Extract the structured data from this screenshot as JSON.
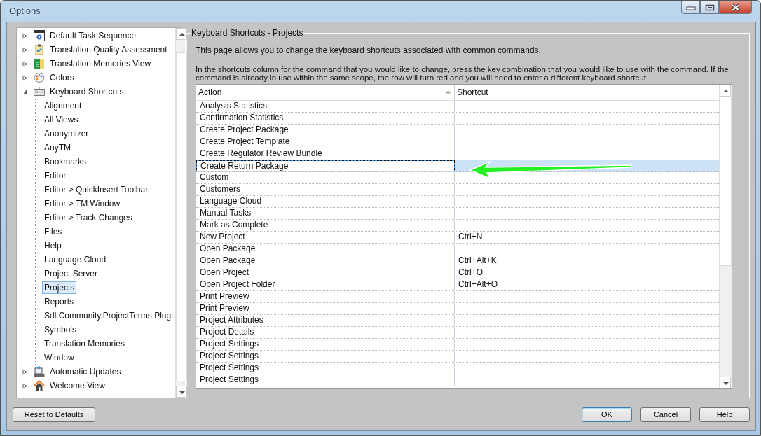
{
  "window": {
    "title": "Options"
  },
  "tree": [
    {
      "label": "Default Task Sequence",
      "expanded": false,
      "selected": false
    },
    {
      "label": "Translation Quality Assessment",
      "expanded": false,
      "selected": false
    },
    {
      "label": "Translation Memories View",
      "expanded": false,
      "selected": false
    },
    {
      "label": "Colors",
      "expanded": false,
      "selected": false
    },
    {
      "label": "Keyboard Shortcuts",
      "expanded": true,
      "selected": false,
      "children": [
        {
          "label": "Alignment",
          "selected": false
        },
        {
          "label": "All Views",
          "selected": false
        },
        {
          "label": "Anonymizer",
          "selected": false
        },
        {
          "label": "AnyTM",
          "selected": false
        },
        {
          "label": "Bookmarks",
          "selected": false
        },
        {
          "label": "Editor",
          "selected": false
        },
        {
          "label": "Editor > QuickInsert Toolbar",
          "selected": false
        },
        {
          "label": "Editor > TM Window",
          "selected": false
        },
        {
          "label": "Editor > Track Changes",
          "selected": false
        },
        {
          "label": "Files",
          "selected": false
        },
        {
          "label": "Help",
          "selected": false
        },
        {
          "label": "Language Cloud",
          "selected": false
        },
        {
          "label": "Project Server",
          "selected": false
        },
        {
          "label": "Projects",
          "selected": true
        },
        {
          "label": "Reports",
          "selected": false
        },
        {
          "label": "Sdl.Community.ProjectTerms.Plugi",
          "selected": false
        },
        {
          "label": "Symbols",
          "selected": false
        },
        {
          "label": "Translation Memories",
          "selected": false
        },
        {
          "label": "Window",
          "selected": false
        }
      ]
    },
    {
      "label": "Automatic Updates",
      "expanded": false,
      "selected": false
    },
    {
      "label": "Welcome View",
      "expanded": false,
      "selected": false
    }
  ],
  "panel": {
    "title": "Keyboard Shortcuts - Projects",
    "intro": "This page allows you to change the keyboard shortcuts associated with common commands.",
    "instructions": "In the shortcuts column for the command that you would like to change, press the key combination that you would like to use with the command.  If the command is already in use within the same scope, the row will turn red and you will need to enter a different keyboard shortcut."
  },
  "table": {
    "columns": [
      "Action",
      "Shortcut"
    ],
    "rows": [
      {
        "action": "Analysis Statistics",
        "shortcut": "",
        "selected": false
      },
      {
        "action": "Confirmation Statistics",
        "shortcut": "",
        "selected": false
      },
      {
        "action": "Create Project Package",
        "shortcut": "",
        "selected": false
      },
      {
        "action": "Create Project Template",
        "shortcut": "",
        "selected": false
      },
      {
        "action": "Create Regulator Review Bundle",
        "shortcut": "",
        "selected": false
      },
      {
        "action": "Create Return Package",
        "shortcut": "",
        "selected": true
      },
      {
        "action": "Custom",
        "shortcut": "",
        "selected": false
      },
      {
        "action": "Customers",
        "shortcut": "",
        "selected": false
      },
      {
        "action": "Language Cloud",
        "shortcut": "",
        "selected": false
      },
      {
        "action": "Manual Tasks",
        "shortcut": "",
        "selected": false
      },
      {
        "action": "Mark as Complete",
        "shortcut": "",
        "selected": false
      },
      {
        "action": "New Project",
        "shortcut": "Ctrl+N",
        "selected": false
      },
      {
        "action": "Open Package",
        "shortcut": "",
        "selected": false
      },
      {
        "action": "Open Package",
        "shortcut": "Ctrl+Alt+K",
        "selected": false
      },
      {
        "action": "Open Project",
        "shortcut": "Ctrl+O",
        "selected": false
      },
      {
        "action": "Open Project Folder",
        "shortcut": "Ctrl+Alt+O",
        "selected": false
      },
      {
        "action": "Print Preview",
        "shortcut": "",
        "selected": false
      },
      {
        "action": "Print Preview",
        "shortcut": "",
        "selected": false
      },
      {
        "action": "Project Attributes",
        "shortcut": "",
        "selected": false
      },
      {
        "action": "Project Details",
        "shortcut": "",
        "selected": false
      },
      {
        "action": "Project Settings",
        "shortcut": "",
        "selected": false
      },
      {
        "action": "Project Settings",
        "shortcut": "",
        "selected": false
      },
      {
        "action": "Project Settings",
        "shortcut": "",
        "selected": false
      },
      {
        "action": "Project Settings",
        "shortcut": "",
        "selected": false
      }
    ]
  },
  "buttons": {
    "reset": "Reset to Defaults",
    "ok": "OK",
    "cancel": "Cancel",
    "help": "Help"
  }
}
